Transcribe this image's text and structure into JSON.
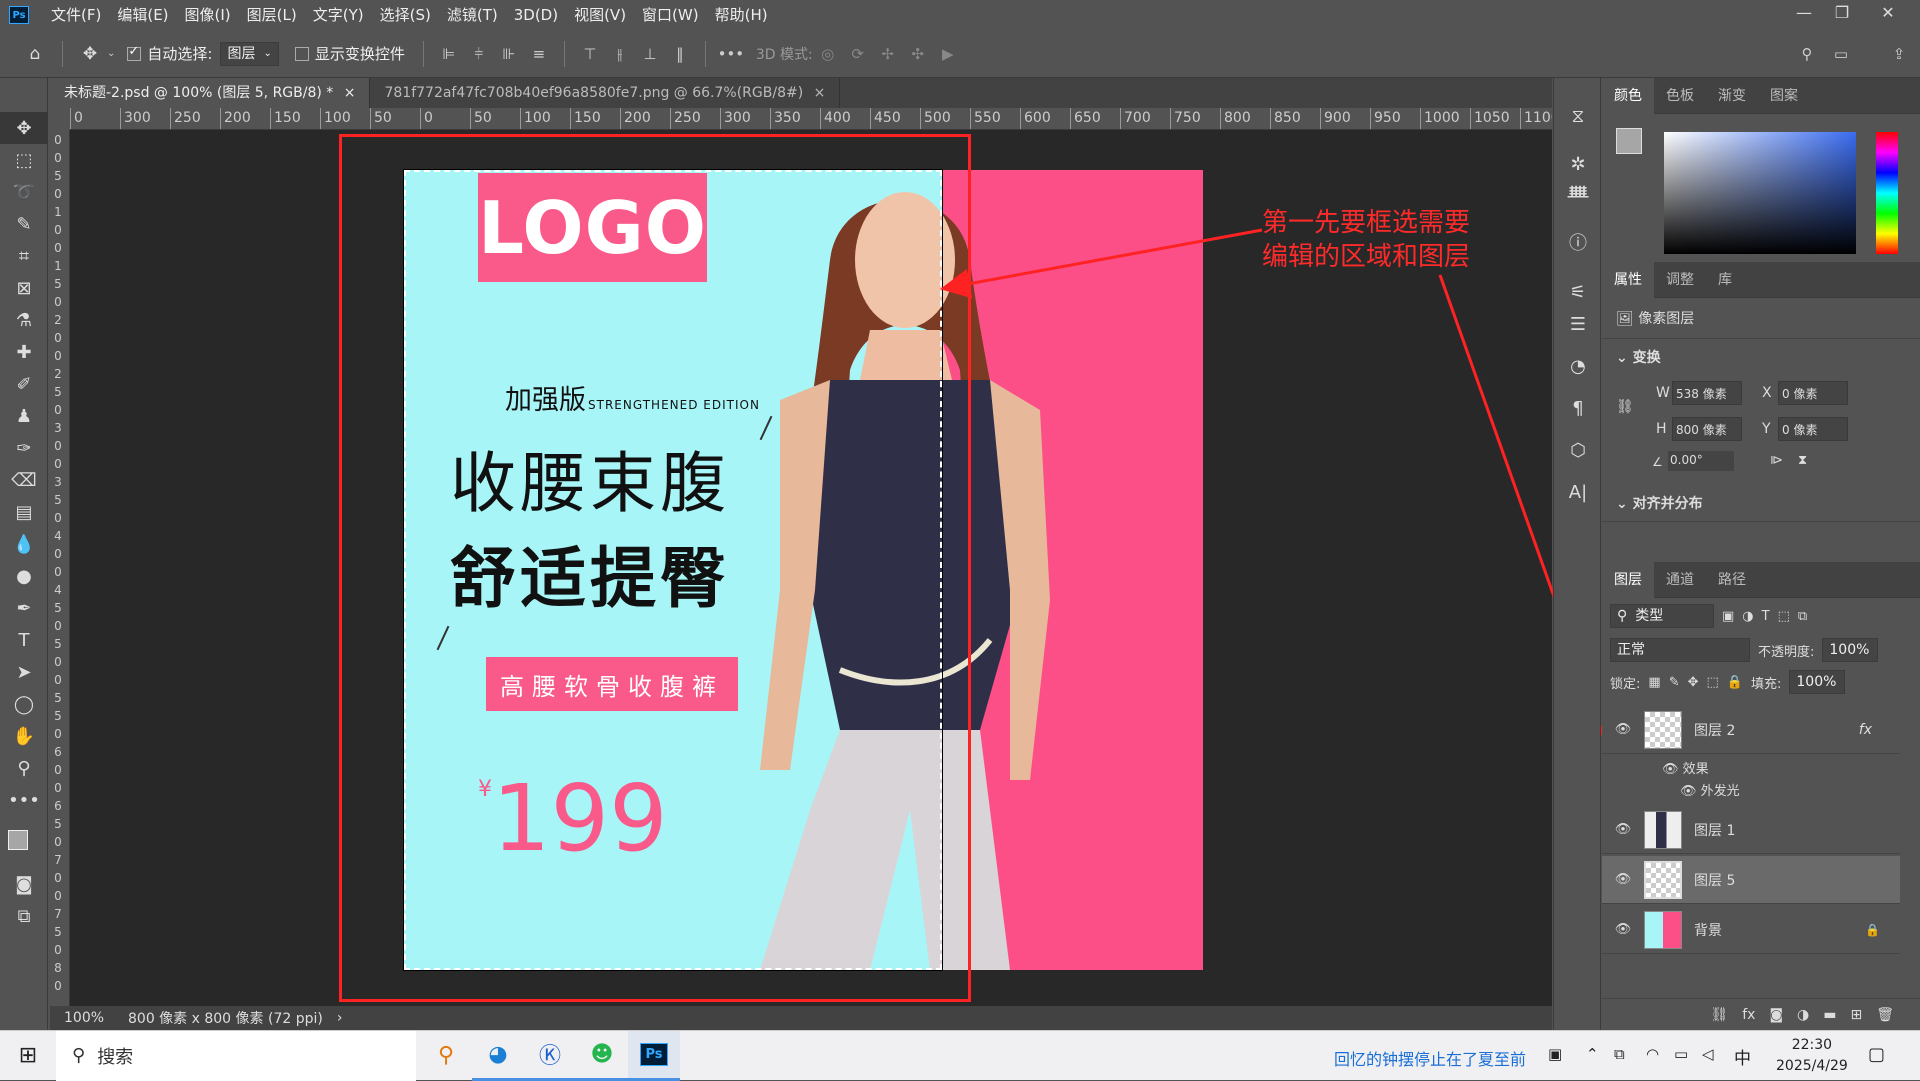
{
  "app": {
    "logo": "Ps"
  },
  "menu": [
    "文件(F)",
    "编辑(E)",
    "图像(I)",
    "图层(L)",
    "文字(Y)",
    "选择(S)",
    "滤镜(T)",
    "3D(D)",
    "视图(V)",
    "窗口(W)",
    "帮助(H)"
  ],
  "options": {
    "auto_select_label": "自动选择:",
    "auto_select_target": "图层",
    "show_transform_label": "显示变换控件",
    "mode_3d_label": "3D 模式:"
  },
  "tabs": [
    {
      "label": "未标题-2.psd @ 100% (图层 5, RGB/8) *"
    },
    {
      "label": "781f772af47fc708b40ef96a8580fe7.png @ 66.7%(RGB/8#)"
    }
  ],
  "ruler": {
    "h": [
      "0",
      "300",
      "250",
      "200",
      "150",
      "100",
      "50",
      "0",
      "50",
      "100",
      "150",
      "200",
      "250",
      "300",
      "350",
      "400",
      "450",
      "500",
      "550",
      "600",
      "650",
      "700",
      "750",
      "800",
      "850",
      "900",
      "950",
      "1000",
      "1050",
      "1100"
    ],
    "v": [
      "0",
      "0",
      "5",
      "0",
      "1",
      "0",
      "0",
      "1",
      "5",
      "0",
      "2",
      "0",
      "0",
      "2",
      "5",
      "0",
      "3",
      "0",
      "0",
      "3",
      "5",
      "0",
      "4",
      "0",
      "0",
      "4",
      "5",
      "0",
      "5",
      "0",
      "0",
      "5",
      "5",
      "0",
      "6",
      "0",
      "0",
      "6",
      "5",
      "0",
      "7",
      "0",
      "0",
      "7",
      "5",
      "0",
      "8",
      "0"
    ]
  },
  "poster": {
    "logo": "LOGO",
    "edition_cn": "加强版",
    "edition_en": "STRENGTHENED EDITION",
    "line1": "收腰束腹",
    "line2": "舒适提臀",
    "tagline": "高腰软骨收腹裤",
    "currency": "¥",
    "price": "199",
    "colors": {
      "teal": "#a8f5f8",
      "pink": "#fc4f87"
    }
  },
  "annotation": {
    "line1": "第一先要框选需要",
    "line2": "编辑的区域和图层"
  },
  "status": {
    "zoom": "100%",
    "doc_size": "800 像素 x 800 像素 (72 ppi)"
  },
  "color_panel": {
    "tabs": [
      "颜色",
      "色板",
      "渐变",
      "图案"
    ]
  },
  "properties": {
    "tabs": [
      "属性",
      "调整",
      "库"
    ],
    "layer_type": "像素图层",
    "transform_title": "变换",
    "w_label": "W",
    "w": "538 像素",
    "h_label": "H",
    "h": "800 像素",
    "x_label": "X",
    "x": "0 像素",
    "y_label": "Y",
    "y": "0 像素",
    "angle": "0.00°",
    "align_title": "对齐并分布"
  },
  "layers_panel": {
    "tabs": [
      "图层",
      "通道",
      "路径"
    ],
    "filter": "类型",
    "blend": "正常",
    "opacity_label": "不透明度:",
    "opacity": "100%",
    "lock_label": "锁定:",
    "fill_label": "填充:",
    "fill": "100%",
    "layers": [
      {
        "name": "图层 2",
        "fx": "fx"
      },
      {
        "name": "效果"
      },
      {
        "name": "外发光"
      },
      {
        "name": "图层 1"
      },
      {
        "name": "图层 5"
      },
      {
        "name": "背景"
      }
    ]
  },
  "taskbar": {
    "search": "搜索",
    "music": "回忆的钟摆停止在了夏至前",
    "ime": "中",
    "time": "22:30",
    "date": "2025/4/29"
  }
}
